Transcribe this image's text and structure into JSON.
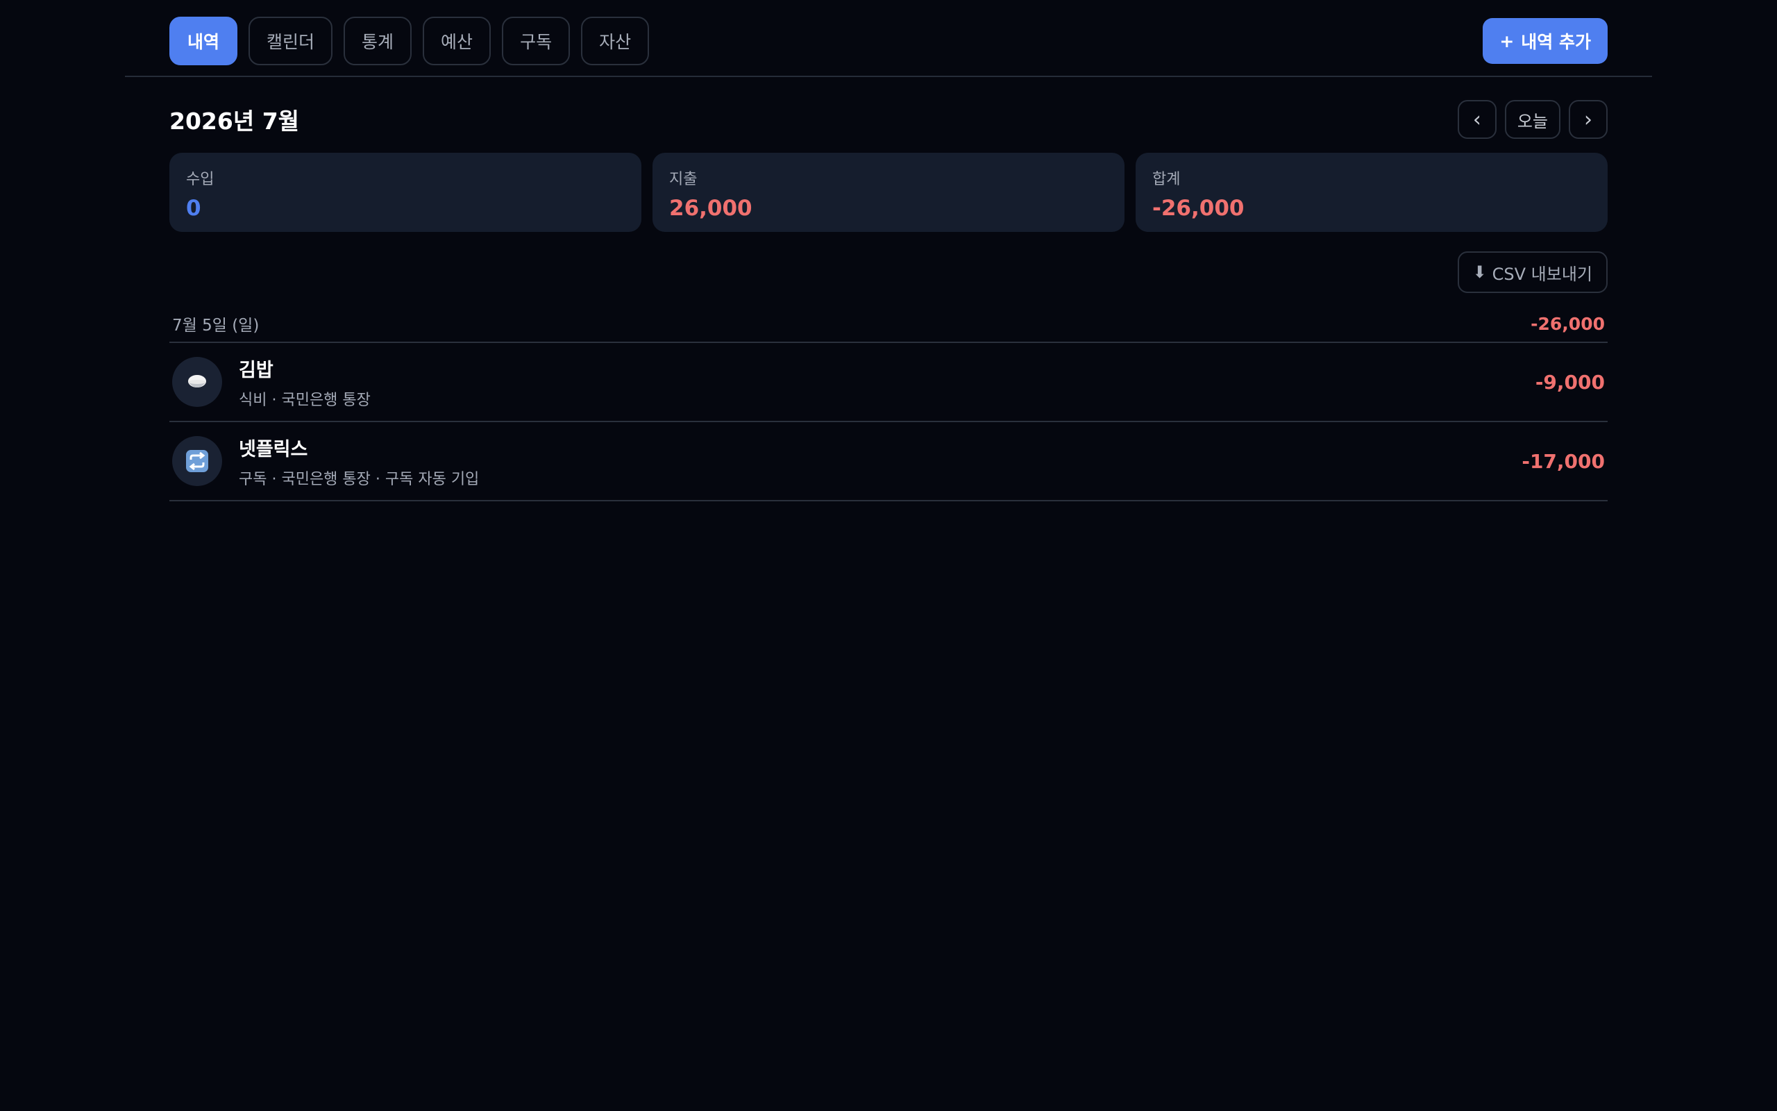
{
  "tabs": [
    {
      "label": "내역",
      "active": true
    },
    {
      "label": "캘린더",
      "active": false
    },
    {
      "label": "통계",
      "active": false
    },
    {
      "label": "예산",
      "active": false
    },
    {
      "label": "구독",
      "active": false
    },
    {
      "label": "자산",
      "active": false
    }
  ],
  "add_button": {
    "icon": "+",
    "label": "내역 추가"
  },
  "month_title": "2026년 7월",
  "nav": {
    "prev": "‹",
    "today": "오늘",
    "next": "›"
  },
  "summary": {
    "income": {
      "label": "수입",
      "value": "0"
    },
    "expense": {
      "label": "지출",
      "value": "26,000"
    },
    "total": {
      "label": "합계",
      "value": "-26,000"
    }
  },
  "csv_button": {
    "icon": "⬇",
    "label": "CSV 내보내기"
  },
  "day_group": {
    "date": "7월 5일 (일)",
    "total": "-26,000",
    "items": [
      {
        "icon": "rice-bowl-icon",
        "title": "김밥",
        "subtitle": "식비 · 국민은행 통장",
        "amount": "-9,000"
      },
      {
        "icon": "repeat-icon",
        "title": "넷플릭스",
        "subtitle": "구독 · 국민은행 통장 · 구독 자동 기입",
        "amount": "-17,000"
      }
    ]
  },
  "colors": {
    "accent": "#4f7ff0",
    "expense": "#f0716f",
    "background": "#05070f",
    "card": "#151d2d"
  }
}
